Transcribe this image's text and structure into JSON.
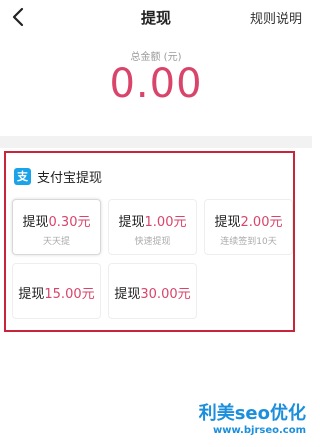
{
  "header": {
    "title": "提现",
    "rules_label": "规则说明"
  },
  "balance": {
    "label": "总金额 (元)",
    "amount": "0.00"
  },
  "withdraw": {
    "method_label": "支付宝提现",
    "method_icon_glyph": "支",
    "prefix": "提现",
    "options": [
      {
        "amount": "0.30元",
        "note": "天天提",
        "selected": true
      },
      {
        "amount": "1.00元",
        "note": "快速提现",
        "selected": false
      },
      {
        "amount": "2.00元",
        "note": "连续签到10天",
        "selected": false
      },
      {
        "amount": "15.00元",
        "note": "",
        "selected": false
      },
      {
        "amount": "30.00元",
        "note": "",
        "selected": false
      }
    ]
  },
  "watermark": {
    "title": "利美seo优化",
    "url": "www.bjrseo.com"
  },
  "colors": {
    "accent": "#d9456a",
    "highlight_border": "#c8253a",
    "alipay_blue": "#1aa3e8",
    "watermark_blue": "#1c8fdc"
  },
  "icons": {
    "back": "chevron-left-icon",
    "alipay": "alipay-icon"
  }
}
